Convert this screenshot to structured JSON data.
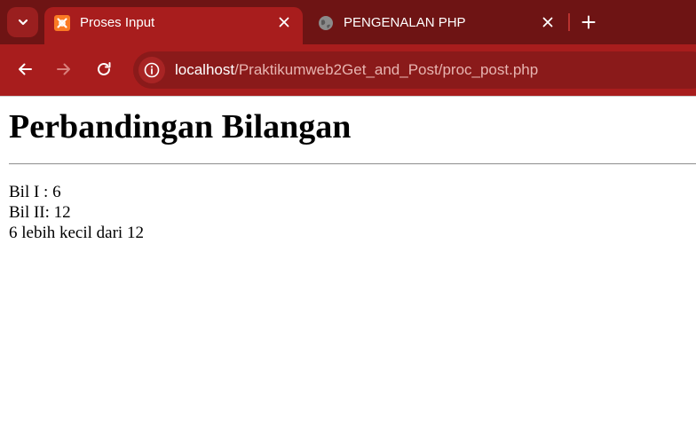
{
  "browser": {
    "colors": {
      "tabbar": "#6e1414",
      "active_tab": "#a81d1d",
      "toolbar": "#a81d1d",
      "omnibox": "#8a1a1a"
    },
    "tabs": [
      {
        "title": "Proses Input",
        "active": true,
        "favicon": "xampp-icon"
      },
      {
        "title": "PENGENALAN PHP",
        "active": false,
        "favicon": "globe-icon"
      }
    ],
    "address_bar": {
      "host": "localhost",
      "path": "/Praktikumweb2Get_and_Post/proc_post.php"
    }
  },
  "page": {
    "heading": "Perbandingan Bilangan",
    "lines": [
      "Bil I : 6",
      "Bil II: 12",
      "6 lebih kecil dari 12"
    ]
  }
}
